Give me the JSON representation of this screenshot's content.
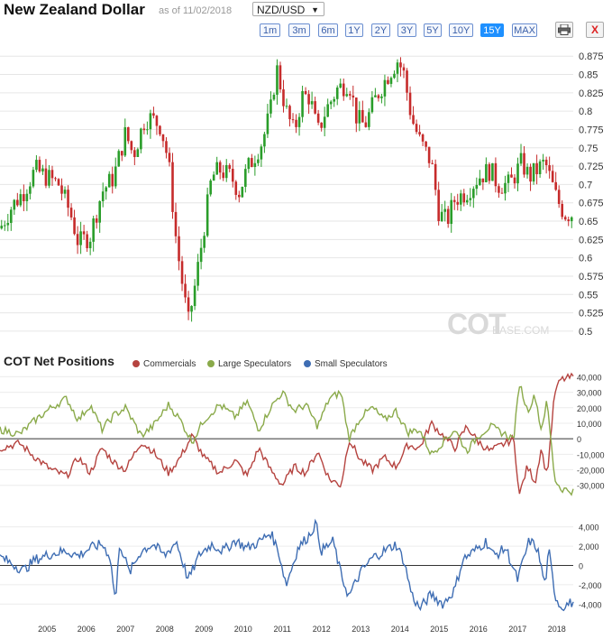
{
  "header": {
    "title": "New Zealand Dollar",
    "as_of": "as of 11/02/2018",
    "pair": "NZD/USD",
    "ranges": [
      "1m",
      "3m",
      "6m",
      "1Y",
      "2Y",
      "3Y",
      "5Y",
      "10Y",
      "15Y",
      "MAX"
    ],
    "active_range": "15Y",
    "print_icon": "printer-icon",
    "close_label": "X"
  },
  "watermark": {
    "main": "COT",
    "sub": "BASE.COM"
  },
  "cot": {
    "title": "COT Net Positions",
    "legend": [
      {
        "label": "Commercials",
        "color": "#b5433f"
      },
      {
        "label": "Large Speculators",
        "color": "#8aaa4a"
      },
      {
        "label": "Small Speculators",
        "color": "#3e6db3"
      }
    ]
  },
  "chart_data": [
    {
      "type": "candlestick",
      "title": "New Zealand Dollar",
      "x_range": [
        2004.3,
        2018.92
      ],
      "ylim": [
        0.49,
        0.89
      ],
      "y_ticks": [
        "0.875",
        "0.85",
        "0.825",
        "0.8",
        "0.775",
        "0.75",
        "0.725",
        "0.7",
        "0.675",
        "0.65",
        "0.625",
        "0.6",
        "0.575",
        "0.55",
        "0.525",
        "0.5"
      ],
      "up_color": "#2a9d2a",
      "down_color": "#c62b2b",
      "close_path": [
        [
          2004.3,
          0.64
        ],
        [
          2004.6,
          0.67
        ],
        [
          2004.9,
          0.69
        ],
        [
          2005.2,
          0.72
        ],
        [
          2005.5,
          0.71
        ],
        [
          2005.8,
          0.7
        ],
        [
          2006.1,
          0.66
        ],
        [
          2006.3,
          0.62
        ],
        [
          2006.6,
          0.63
        ],
        [
          2006.9,
          0.69
        ],
        [
          2007.2,
          0.71
        ],
        [
          2007.5,
          0.77
        ],
        [
          2007.7,
          0.74
        ],
        [
          2008.0,
          0.79
        ],
        [
          2008.15,
          0.79
        ],
        [
          2008.4,
          0.78
        ],
        [
          2008.6,
          0.73
        ],
        [
          2008.8,
          0.62
        ],
        [
          2009.1,
          0.51
        ],
        [
          2009.3,
          0.57
        ],
        [
          2009.5,
          0.64
        ],
        [
          2009.7,
          0.71
        ],
        [
          2009.9,
          0.72
        ],
        [
          2010.2,
          0.71
        ],
        [
          2010.4,
          0.69
        ],
        [
          2010.6,
          0.72
        ],
        [
          2010.8,
          0.74
        ],
        [
          2011.0,
          0.76
        ],
        [
          2011.2,
          0.8
        ],
        [
          2011.35,
          0.86
        ],
        [
          2011.6,
          0.8
        ],
        [
          2011.8,
          0.77
        ],
        [
          2012.0,
          0.82
        ],
        [
          2012.2,
          0.82
        ],
        [
          2012.4,
          0.77
        ],
        [
          2012.6,
          0.8
        ],
        [
          2012.9,
          0.83
        ],
        [
          2013.2,
          0.84
        ],
        [
          2013.4,
          0.79
        ],
        [
          2013.6,
          0.78
        ],
        [
          2013.9,
          0.82
        ],
        [
          2014.2,
          0.85
        ],
        [
          2014.45,
          0.87
        ],
        [
          2014.6,
          0.85
        ],
        [
          2014.8,
          0.79
        ],
        [
          2015.0,
          0.76
        ],
        [
          2015.3,
          0.73
        ],
        [
          2015.5,
          0.66
        ],
        [
          2015.7,
          0.65
        ],
        [
          2015.9,
          0.68
        ],
        [
          2016.2,
          0.69
        ],
        [
          2016.5,
          0.71
        ],
        [
          2016.8,
          0.72
        ],
        [
          2017.0,
          0.7
        ],
        [
          2017.3,
          0.7
        ],
        [
          2017.6,
          0.73
        ],
        [
          2017.8,
          0.71
        ],
        [
          2018.0,
          0.72
        ],
        [
          2018.2,
          0.73
        ],
        [
          2018.5,
          0.68
        ],
        [
          2018.7,
          0.66
        ],
        [
          2018.92,
          0.66
        ]
      ]
    },
    {
      "type": "line",
      "title": "COT Net Positions",
      "x_range": [
        2004.3,
        2018.92
      ],
      "ylim": [
        -36000,
        42000
      ],
      "y_ticks": [
        "40,000",
        "30,000",
        "20,000",
        "10,000",
        "0",
        "-10,000",
        "-20,000",
        "-30,000"
      ],
      "series": [
        {
          "name": "Commercials",
          "color": "#b5433f",
          "points": [
            [
              2004.3,
              -6000
            ],
            [
              2004.8,
              -3000
            ],
            [
              2005.2,
              -12000
            ],
            [
              2005.6,
              -20000
            ],
            [
              2006.0,
              -24000
            ],
            [
              2006.3,
              -12000
            ],
            [
              2006.6,
              -22000
            ],
            [
              2006.9,
              -6000
            ],
            [
              2007.2,
              -15000
            ],
            [
              2007.5,
              -20000
            ],
            [
              2007.9,
              -2000
            ],
            [
              2008.2,
              -8000
            ],
            [
              2008.6,
              -22000
            ],
            [
              2008.9,
              -12000
            ],
            [
              2009.2,
              2000
            ],
            [
              2009.5,
              -12000
            ],
            [
              2009.9,
              -22000
            ],
            [
              2010.3,
              -14000
            ],
            [
              2010.6,
              -24000
            ],
            [
              2010.9,
              -6000
            ],
            [
              2011.2,
              -20000
            ],
            [
              2011.5,
              -30000
            ],
            [
              2011.8,
              -18000
            ],
            [
              2012.1,
              -22000
            ],
            [
              2012.4,
              -8000
            ],
            [
              2012.7,
              -26000
            ],
            [
              2013.0,
              -30000
            ],
            [
              2013.2,
              0
            ],
            [
              2013.5,
              -14000
            ],
            [
              2013.8,
              -20000
            ],
            [
              2014.1,
              -12000
            ],
            [
              2014.4,
              -18000
            ],
            [
              2014.7,
              -4000
            ],
            [
              2015.0,
              -6000
            ],
            [
              2015.3,
              10000
            ],
            [
              2015.6,
              2000
            ],
            [
              2015.9,
              -6000
            ],
            [
              2016.2,
              8000
            ],
            [
              2016.5,
              -2000
            ],
            [
              2016.8,
              -8000
            ],
            [
              2017.1,
              -4000
            ],
            [
              2017.4,
              0
            ],
            [
              2017.55,
              -36000
            ],
            [
              2017.75,
              -18000
            ],
            [
              2017.95,
              -28000
            ],
            [
              2018.1,
              -6000
            ],
            [
              2018.25,
              -24000
            ],
            [
              2018.45,
              30000
            ],
            [
              2018.6,
              38000
            ],
            [
              2018.92,
              40000
            ]
          ]
        },
        {
          "name": "Large Speculators",
          "color": "#8aaa4a",
          "points": [
            [
              2004.3,
              6000
            ],
            [
              2004.8,
              3000
            ],
            [
              2005.2,
              12000
            ],
            [
              2005.6,
              20000
            ],
            [
              2006.0,
              26000
            ],
            [
              2006.3,
              12000
            ],
            [
              2006.6,
              22000
            ],
            [
              2006.9,
              6000
            ],
            [
              2007.2,
              15000
            ],
            [
              2007.5,
              20000
            ],
            [
              2007.9,
              2000
            ],
            [
              2008.2,
              8000
            ],
            [
              2008.6,
              22000
            ],
            [
              2008.9,
              12000
            ],
            [
              2009.2,
              -2000
            ],
            [
              2009.5,
              12000
            ],
            [
              2009.9,
              22000
            ],
            [
              2010.3,
              14000
            ],
            [
              2010.6,
              24000
            ],
            [
              2010.9,
              6000
            ],
            [
              2011.2,
              20000
            ],
            [
              2011.5,
              30000
            ],
            [
              2011.8,
              18000
            ],
            [
              2012.1,
              22000
            ],
            [
              2012.4,
              8000
            ],
            [
              2012.7,
              26000
            ],
            [
              2013.0,
              30000
            ],
            [
              2013.2,
              0
            ],
            [
              2013.5,
              14000
            ],
            [
              2013.8,
              20000
            ],
            [
              2014.1,
              12000
            ],
            [
              2014.4,
              18000
            ],
            [
              2014.7,
              4000
            ],
            [
              2015.0,
              6000
            ],
            [
              2015.3,
              -10000
            ],
            [
              2015.6,
              -2000
            ],
            [
              2015.9,
              6000
            ],
            [
              2016.2,
              -8000
            ],
            [
              2016.5,
              2000
            ],
            [
              2016.8,
              8000
            ],
            [
              2017.1,
              4000
            ],
            [
              2017.4,
              0
            ],
            [
              2017.55,
              36000
            ],
            [
              2017.75,
              18000
            ],
            [
              2017.95,
              28000
            ],
            [
              2018.1,
              6000
            ],
            [
              2018.25,
              24000
            ],
            [
              2018.45,
              -26000
            ],
            [
              2018.6,
              -32000
            ],
            [
              2018.92,
              -34000
            ]
          ]
        }
      ]
    },
    {
      "type": "line",
      "x_range": [
        2004.3,
        2018.92
      ],
      "ylim": [
        -5000,
        5000
      ],
      "y_ticks": [
        "4,000",
        "2,000",
        "0",
        "-2,000",
        "-4,000"
      ],
      "x_ticks": [
        "2005",
        "2006",
        "2007",
        "2008",
        "2009",
        "2010",
        "2011",
        "2012",
        "2013",
        "2014",
        "2015",
        "2016",
        "2017",
        "2018"
      ],
      "series": [
        {
          "name": "Small Speculators",
          "color": "#3e6db3",
          "points": [
            [
              2004.3,
              900
            ],
            [
              2004.6,
              200
            ],
            [
              2004.9,
              -500
            ],
            [
              2005.2,
              600
            ],
            [
              2005.6,
              1200
            ],
            [
              2006.0,
              1500
            ],
            [
              2006.3,
              1000
            ],
            [
              2006.6,
              1800
            ],
            [
              2006.9,
              2200
            ],
            [
              2007.1,
              1000
            ],
            [
              2007.25,
              -3800
            ],
            [
              2007.35,
              2400
            ],
            [
              2007.6,
              -800
            ],
            [
              2007.9,
              1500
            ],
            [
              2008.2,
              2200
            ],
            [
              2008.5,
              1000
            ],
            [
              2008.8,
              2500
            ],
            [
              2009.1,
              -1500
            ],
            [
              2009.4,
              1200
            ],
            [
              2009.7,
              2200
            ],
            [
              2010.0,
              1500
            ],
            [
              2010.3,
              2600
            ],
            [
              2010.6,
              1800
            ],
            [
              2010.9,
              2400
            ],
            [
              2011.2,
              3400
            ],
            [
              2011.4,
              1500
            ],
            [
              2011.6,
              -2000
            ],
            [
              2011.9,
              1800
            ],
            [
              2012.2,
              3200
            ],
            [
              2012.35,
              4400
            ],
            [
              2012.5,
              1500
            ],
            [
              2012.8,
              2500
            ],
            [
              2013.0,
              -1000
            ],
            [
              2013.2,
              -3200
            ],
            [
              2013.5,
              -700
            ],
            [
              2013.8,
              800
            ],
            [
              2014.1,
              1500
            ],
            [
              2014.4,
              2200
            ],
            [
              2014.6,
              500
            ],
            [
              2014.8,
              -3000
            ],
            [
              2015.0,
              -4500
            ],
            [
              2015.3,
              -3000
            ],
            [
              2015.6,
              -4000
            ],
            [
              2015.9,
              -2500
            ],
            [
              2016.1,
              600
            ],
            [
              2016.4,
              1500
            ],
            [
              2016.7,
              2500
            ],
            [
              2016.9,
              1000
            ],
            [
              2017.2,
              1800
            ],
            [
              2017.5,
              -1500
            ],
            [
              2017.8,
              2600
            ],
            [
              2018.0,
              1800
            ],
            [
              2018.2,
              -2000
            ],
            [
              2018.3,
              1500
            ],
            [
              2018.45,
              -3000
            ],
            [
              2018.6,
              -4300
            ],
            [
              2018.92,
              -3800
            ]
          ]
        }
      ]
    }
  ]
}
